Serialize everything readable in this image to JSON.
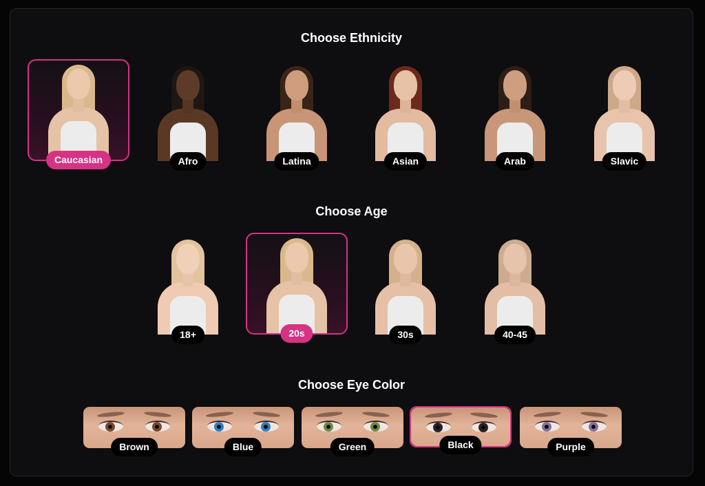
{
  "progress": 0.1,
  "colors": {
    "accent": "#d63384",
    "background": "#050505",
    "panel": "#0e0d10"
  },
  "sections": {
    "ethnicity": {
      "title": "Choose Ethnicity",
      "selected": "Caucasian",
      "options": [
        {
          "label": "Caucasian"
        },
        {
          "label": "Afro"
        },
        {
          "label": "Latina"
        },
        {
          "label": "Asian"
        },
        {
          "label": "Arab"
        },
        {
          "label": "Slavic"
        }
      ]
    },
    "age": {
      "title": "Choose Age",
      "selected": "20s",
      "options": [
        {
          "label": "18+"
        },
        {
          "label": "20s"
        },
        {
          "label": "30s"
        },
        {
          "label": "40-45"
        }
      ]
    },
    "eye_color": {
      "title": "Choose Eye Color",
      "selected": "Black",
      "options": [
        {
          "label": "Brown",
          "iris": "#7a4a2a"
        },
        {
          "label": "Blue",
          "iris": "#2f7fc4"
        },
        {
          "label": "Green",
          "iris": "#6e8a4a"
        },
        {
          "label": "Black",
          "iris": "#2b2323"
        },
        {
          "label": "Purple",
          "iris": "#8a6f9a"
        }
      ]
    }
  }
}
